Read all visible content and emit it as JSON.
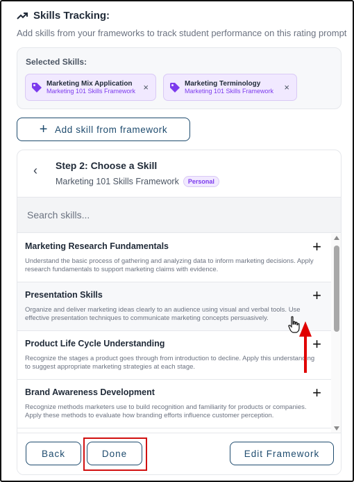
{
  "header": {
    "icon": "trending-up-icon",
    "title": "Skills Tracking:",
    "subtitle": "Add skills from your frameworks to track student performance on this rating prompt"
  },
  "selected": {
    "label": "Selected Skills:",
    "chips": [
      {
        "name": "Marketing Mix Application",
        "framework": "Marketing 101 Skills Framework",
        "remove": "×"
      },
      {
        "name": "Marketing Terminology",
        "framework": "Marketing 101 Skills Framework",
        "remove": "×"
      }
    ]
  },
  "add_button": {
    "icon": "+",
    "label": "Add skill from framework"
  },
  "panel": {
    "back_icon": "‹",
    "title": "Step 2: Choose a Skill",
    "framework": "Marketing 101 Skills Framework",
    "badge": "Personal",
    "search_placeholder": "Search skills..."
  },
  "skills": [
    {
      "title": "Marketing Research Fundamentals",
      "desc": "Understand the basic process of gathering and analyzing data to inform marketing decisions. Apply research fundamentals to support marketing claims with evidence.",
      "add": "+"
    },
    {
      "title": "Presentation Skills",
      "desc": "Organize and deliver marketing ideas clearly to an audience using visual and verbal tools. Use effective presentation techniques to communicate marketing concepts persuasively.",
      "add": "+"
    },
    {
      "title": "Product Life Cycle Understanding",
      "desc": "Recognize the stages a product goes through from introduction to decline. Apply this understanding to suggest appropriate marketing strategies at each stage.",
      "add": "+"
    },
    {
      "title": "Brand Awareness Development",
      "desc": "Recognize methods marketers use to build recognition and familiarity for products or companies. Apply these methods to evaluate how branding efforts influence customer perception.",
      "add": "+"
    }
  ],
  "footer": {
    "back": "Back",
    "done": "Done",
    "edit": "Edit Framework"
  },
  "colors": {
    "accent": "#1e4b6e",
    "chip_bg": "#f1e9ff",
    "chip_text": "#7c3aed",
    "highlight": "#d10f0f"
  }
}
